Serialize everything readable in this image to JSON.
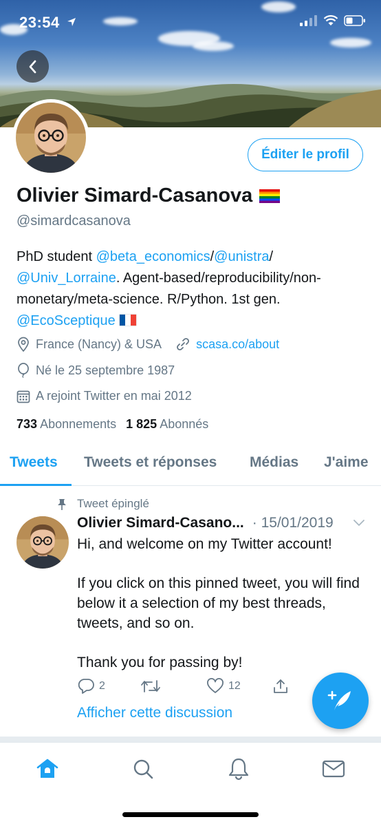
{
  "status_bar": {
    "time": "23:54"
  },
  "header": {
    "back_label": "Back"
  },
  "profile": {
    "edit_button": "Éditer le profil",
    "name": "Olivier Simard-Casanova",
    "handle": "@simardcasanova",
    "bio": {
      "t1": "PhD student ",
      "l1": "@beta_economics",
      "t2": "/",
      "l2": "@unistra",
      "t3": "/",
      "l3": "@Univ_Lorraine",
      "t4": ". Agent-based/reproducibility/non-monetary/meta-science. R/Python. 1st gen.",
      "l4": "@EcoSceptique"
    },
    "location": "France (Nancy) & USA",
    "website": "scasa.co/about",
    "birthday": "Né le 25 septembre 1987",
    "joined": "A rejoint Twitter en mai 2012",
    "following_count": "733",
    "following_label": "Abonnements",
    "followers_count": "1 825",
    "followers_label": "Abonnés"
  },
  "tabs": [
    {
      "label": "Tweets",
      "active": true
    },
    {
      "label": "Tweets et réponses",
      "active": false
    },
    {
      "label": "Médias",
      "active": false
    },
    {
      "label": "J'aime",
      "active": false
    }
  ],
  "pinned_tweet": {
    "pinned_label": "Tweet épinglé",
    "author": "Olivier Simard-Casano...",
    "date": "· 15/01/2019",
    "paragraphs": [
      "Hi, and welcome on my Twitter account!",
      "If you click on this pinned tweet, you will find below it a selection of my best threads, tweets, and so on.",
      "Thank you for passing by!"
    ],
    "reply_count": "2",
    "retweet_count": "",
    "like_count": "12",
    "show_thread": "Afficher cette discussion"
  },
  "colors": {
    "accent": "#1da1f2",
    "secondary_text": "#657786",
    "primary_text": "#14171a"
  },
  "icons": {
    "nav": [
      "home-icon",
      "search-icon",
      "notifications-icon",
      "messages-icon"
    ],
    "fab": "compose-tweet-icon"
  }
}
